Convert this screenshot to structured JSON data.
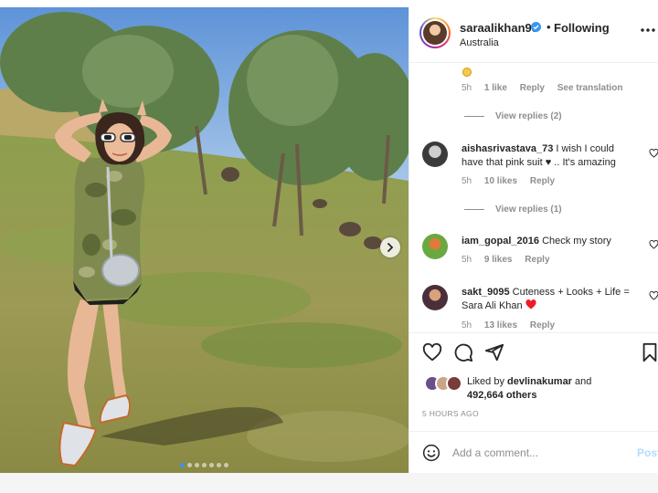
{
  "post": {
    "username": "saraalikhan95",
    "follow_state": "Following",
    "separator": "•",
    "location": "Australia",
    "verified": true,
    "carousel": {
      "slides": 7,
      "active_index": 0
    }
  },
  "comments": {
    "top_comment_meta": {
      "time": "5h",
      "likes": "1 like",
      "reply": "Reply",
      "translate": "See translation"
    },
    "view_replies_1": "View replies (2)",
    "items": [
      {
        "username": "aishasrivastava_73",
        "text": "I wish I could have that pink suit ♥ .. It's amazing",
        "time": "5h",
        "likes": "10 likes",
        "reply": "Reply"
      },
      {
        "view_replies": "View replies (1)"
      },
      {
        "username": "iam_gopal_2016",
        "text": "Check my story",
        "time": "5h",
        "likes": "9 likes",
        "reply": "Reply"
      },
      {
        "username": "sakt_9095",
        "text": "Cuteness + Looks + Life = Sara Ali Khan",
        "time": "5h",
        "likes": "13 likes",
        "reply": "Reply"
      }
    ]
  },
  "actions": {
    "like_icon": "heart-icon",
    "comment_icon": "comment-bubble-icon",
    "share_icon": "paper-plane-icon",
    "save_icon": "bookmark-icon",
    "liked_prefix": "Liked by",
    "liked_user": "devlinakumar",
    "liked_and": "and",
    "liked_others": "492,664 others",
    "timestamp": "5 HOURS AGO"
  },
  "add_comment": {
    "placeholder": "Add a comment...",
    "post_label": "Post",
    "emoji_icon": "smiley-icon"
  },
  "colors": {
    "verified_blue": "#3897f0",
    "post_button_disabled": "#b3dbff",
    "heart_red": "#ed1c24",
    "muted_text": "#8e8e8e"
  }
}
